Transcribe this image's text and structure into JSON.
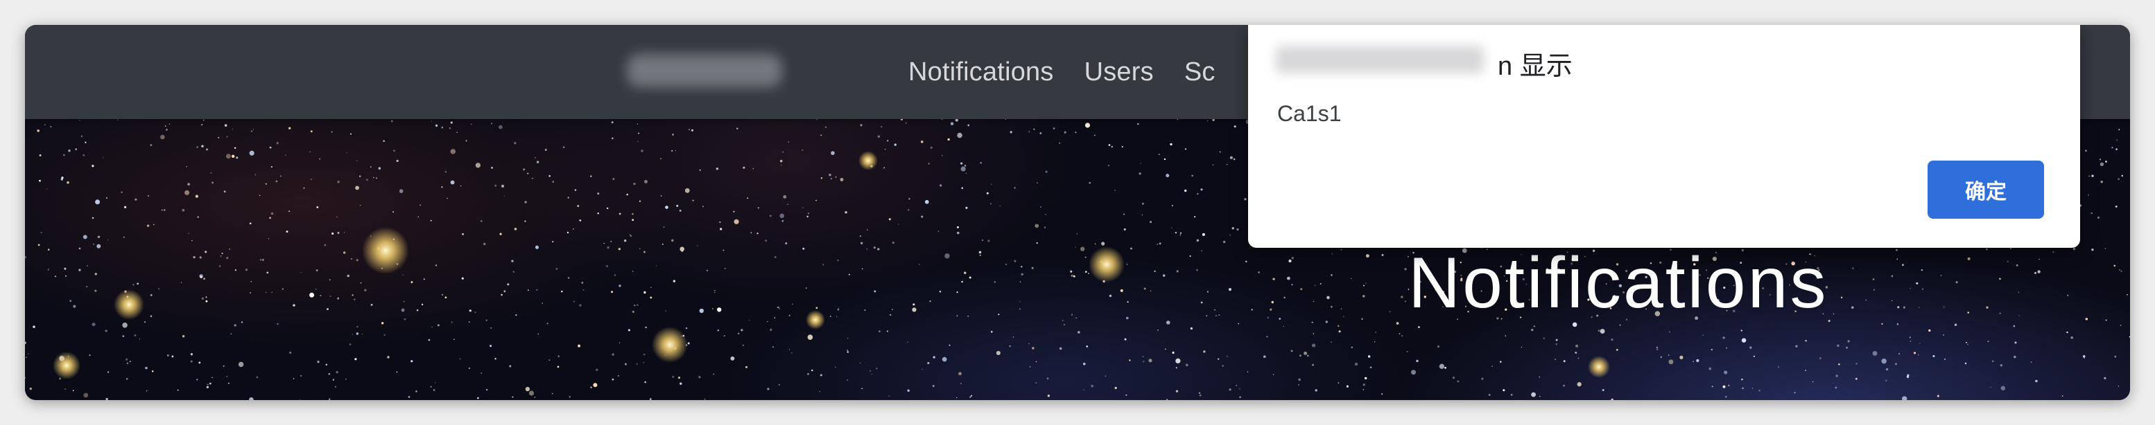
{
  "navbar": {
    "brand_label": "",
    "links": [
      "Notifications",
      "Users",
      "Sc"
    ]
  },
  "hero": {
    "title": "Notifications"
  },
  "dialog": {
    "origin_suffix": "n 显示",
    "message": "Ca1s1",
    "ok_label": "确定"
  },
  "colors": {
    "navbar_bg": "#343a40",
    "ok_button": "#2f6fdc"
  }
}
